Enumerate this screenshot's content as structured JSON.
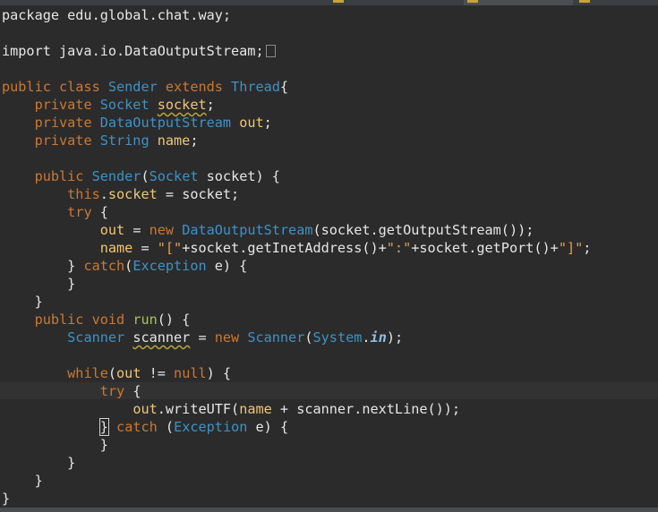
{
  "colors": {
    "background": "#2b2b2b",
    "default_text": "#e6e6e6",
    "keyword": "#cc7832",
    "type": "#3d93c7",
    "field": "#f0c674",
    "string": "#dfa15a",
    "current_line": "#323232"
  },
  "editor": {
    "tabs": [
      {
        "icon": "java-file-icon"
      },
      {
        "icon": "java-file-icon"
      },
      {
        "icon": "java-file-icon"
      }
    ],
    "lines": [
      [
        [
          "d",
          "package edu.global.chat.way;"
        ]
      ],
      [],
      [
        [
          "d",
          "import java.io.DataOutputStream;"
        ],
        [
          "fold",
          ""
        ]
      ],
      [],
      [
        [
          "k",
          "public class "
        ],
        [
          "t",
          "Sender "
        ],
        [
          "k",
          "extends "
        ],
        [
          "t",
          "Thread"
        ],
        [
          "d",
          "{"
        ]
      ],
      [
        [
          "d",
          "    "
        ],
        [
          "k",
          "private "
        ],
        [
          "t",
          "Socket "
        ],
        [
          "fw",
          "socket"
        ],
        [
          "d",
          ";"
        ]
      ],
      [
        [
          "d",
          "    "
        ],
        [
          "k",
          "private "
        ],
        [
          "t",
          "DataOutputStream "
        ],
        [
          "f",
          "out"
        ],
        [
          "d",
          ";"
        ]
      ],
      [
        [
          "d",
          "    "
        ],
        [
          "k",
          "private "
        ],
        [
          "t",
          "String "
        ],
        [
          "f",
          "name"
        ],
        [
          "d",
          ";"
        ]
      ],
      [],
      [
        [
          "d",
          "    "
        ],
        [
          "k",
          "public "
        ],
        [
          "t",
          "Sender"
        ],
        [
          "d",
          "("
        ],
        [
          "t",
          "Socket "
        ],
        [
          "d",
          "socket) {"
        ]
      ],
      [
        [
          "d",
          "        "
        ],
        [
          "k",
          "this"
        ],
        [
          "d",
          "."
        ],
        [
          "f",
          "socket"
        ],
        [
          "d",
          " = socket;"
        ]
      ],
      [
        [
          "d",
          "        "
        ],
        [
          "k",
          "try "
        ],
        [
          "d",
          "{"
        ]
      ],
      [
        [
          "d",
          "            "
        ],
        [
          "f",
          "out"
        ],
        [
          "d",
          " = "
        ],
        [
          "k",
          "new "
        ],
        [
          "t",
          "DataOutputStream"
        ],
        [
          "d",
          "(socket.getOutputStream());"
        ]
      ],
      [
        [
          "d",
          "            "
        ],
        [
          "f",
          "name"
        ],
        [
          "d",
          " = "
        ],
        [
          "s",
          "\"[\""
        ],
        [
          "d",
          "+socket.getInetAddress()+"
        ],
        [
          "s",
          "\":\""
        ],
        [
          "d",
          "+socket.getPort()+"
        ],
        [
          "s",
          "\"]\""
        ],
        [
          "d",
          ";"
        ]
      ],
      [
        [
          "d",
          "        } "
        ],
        [
          "k",
          "catch"
        ],
        [
          "d",
          "("
        ],
        [
          "t",
          "Exception "
        ],
        [
          "d",
          "e) {"
        ]
      ],
      [
        [
          "d",
          "        }"
        ]
      ],
      [
        [
          "d",
          "    }"
        ]
      ],
      [
        [
          "d",
          "    "
        ],
        [
          "k",
          "public void "
        ],
        [
          "n",
          "run"
        ],
        [
          "d",
          "() {"
        ]
      ],
      [
        [
          "d",
          "        "
        ],
        [
          "t",
          "Scanner "
        ],
        [
          "w",
          "scanner"
        ],
        [
          "d",
          " = "
        ],
        [
          "k",
          "new "
        ],
        [
          "t",
          "Scanner"
        ],
        [
          "d",
          "("
        ],
        [
          "t",
          "System"
        ],
        [
          "d",
          "."
        ],
        [
          "si",
          "in"
        ],
        [
          "d",
          ");"
        ]
      ],
      [],
      [
        [
          "d",
          "        "
        ],
        [
          "k",
          "while"
        ],
        [
          "d",
          "("
        ],
        [
          "f",
          "out"
        ],
        [
          "d",
          " != "
        ],
        [
          "k",
          "null"
        ],
        [
          "d",
          ") {"
        ]
      ],
      [
        [
          "d",
          "            "
        ],
        [
          "k",
          "try "
        ],
        [
          "d",
          "{"
        ]
      ],
      [
        [
          "d",
          "                "
        ],
        [
          "f",
          "out"
        ],
        [
          "d",
          ".writeUTF("
        ],
        [
          "f",
          "name"
        ],
        [
          "d",
          " + scanner.nextLine());"
        ]
      ],
      [
        [
          "d",
          "            "
        ],
        [
          "c",
          "}"
        ],
        [
          "d",
          " "
        ],
        [
          "k",
          "catch "
        ],
        [
          "d",
          "("
        ],
        [
          "t",
          "Exception "
        ],
        [
          "d",
          "e) {"
        ]
      ],
      [
        [
          "d",
          "            }"
        ]
      ],
      [
        [
          "d",
          "        }"
        ]
      ],
      [
        [
          "d",
          "    }"
        ]
      ],
      [
        [
          "d",
          "}"
        ]
      ]
    ]
  }
}
